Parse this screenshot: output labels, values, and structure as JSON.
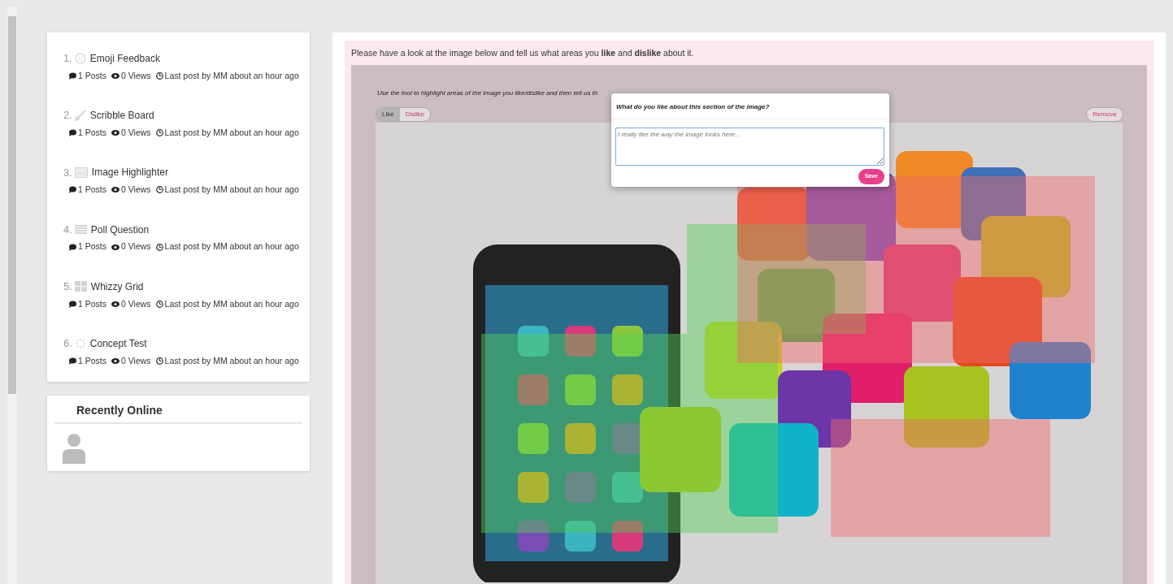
{
  "topics": [
    {
      "number": "1.",
      "kind": "emoji",
      "title": "Emoji Feedback",
      "posts": "1 Posts",
      "views": "0 Views",
      "last_post": "Last post by MM about an hour ago"
    },
    {
      "number": "2.",
      "kind": "brush",
      "title": "Scribble Board",
      "posts": "1 Posts",
      "views": "0 Views",
      "last_post": "Last post by MM about an hour ago"
    },
    {
      "number": "3.",
      "kind": "image",
      "title": "Image Highlighter",
      "posts": "1 Posts",
      "views": "0 Views",
      "last_post": "Last post by MM about an hour ago"
    },
    {
      "number": "4.",
      "kind": "list",
      "title": "Poll Question",
      "posts": "1 Posts",
      "views": "0 Views",
      "last_post": "Last post by MM about an hour ago"
    },
    {
      "number": "5.",
      "kind": "grid",
      "title": "Whizzy Grid",
      "posts": "1 Posts",
      "views": "0 Views",
      "last_post": "Last post by MM about an hour ago"
    },
    {
      "number": "6.",
      "kind": "spinner",
      "title": "Concept Test",
      "posts": "1 Posts",
      "views": "0 Views",
      "last_post": "Last post by MM about an hour ago"
    }
  ],
  "recently_online": {
    "title": "Recently Online"
  },
  "task": {
    "prompt": "Please have a look at the image below and tell us what areas you **like** and **dislike** about it.",
    "instruction": "Use the tool to highlight areas of the image you like/dislike and then tell us th",
    "modes": [
      {
        "label": "Like",
        "selected": true
      },
      {
        "label": "Dislike",
        "selected": false
      }
    ],
    "remove": "Remove"
  },
  "popup": {
    "question": "What do you like about this section of the image?",
    "placeholder": "I really like the way the image looks here...",
    "save": "Save"
  }
}
